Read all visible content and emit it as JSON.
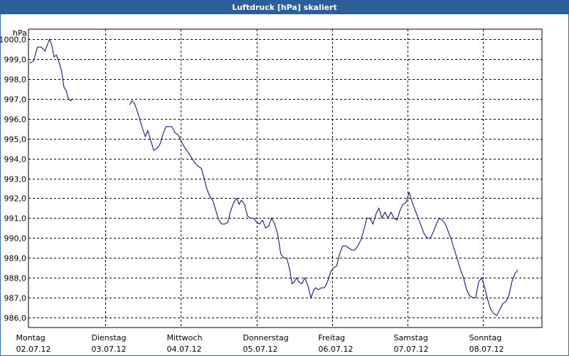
{
  "window": {
    "title": "Luftdruck [hPa] skaliert"
  },
  "chart_data": {
    "type": "line",
    "title": "Luftdruck [hPa] skaliert",
    "ylabel": "hPa",
    "xlabel": "",
    "ylim": [
      985.5,
      1000.5
    ],
    "yticks": [
      "986,0",
      "987,0",
      "988,0",
      "989,0",
      "990,0",
      "991,0",
      "992,0",
      "993,0",
      "994,0",
      "995,0",
      "996,0",
      "997,0",
      "998,0",
      "999,0",
      "1000,0"
    ],
    "ytick_values": [
      986,
      987,
      988,
      989,
      990,
      991,
      992,
      993,
      994,
      995,
      996,
      997,
      998,
      999,
      1000
    ],
    "xlim": [
      0,
      6.75
    ],
    "xticks": [
      {
        "day": "Montag",
        "date": "02.07.12",
        "x": 0
      },
      {
        "day": "Dienstag",
        "date": "03.07.12",
        "x": 1
      },
      {
        "day": "Mittwoch",
        "date": "04.07.12",
        "x": 2
      },
      {
        "day": "Donnerstag",
        "date": "05.07.12",
        "x": 3
      },
      {
        "day": "Freitag",
        "date": "06.07.12",
        "x": 4
      },
      {
        "day": "Samstag",
        "date": "07.07.12",
        "x": 5
      },
      {
        "day": "Sonntag",
        "date": "08.07.12",
        "x": 6
      }
    ],
    "grid": true,
    "colors": {
      "series": "#00008b",
      "grid": "#000000",
      "title_bg": "#2a5f97"
    },
    "series": [
      {
        "segments": [
          [
            [
              0.0,
              998.8
            ],
            [
              0.05,
              998.9
            ],
            [
              0.1,
              999.6
            ],
            [
              0.15,
              999.6
            ],
            [
              0.2,
              999.4
            ],
            [
              0.26,
              1000.0
            ],
            [
              0.29,
              999.7
            ],
            [
              0.32,
              999.1
            ],
            [
              0.35,
              999.2
            ],
            [
              0.38,
              998.9
            ],
            [
              0.42,
              998.4
            ],
            [
              0.45,
              997.6
            ],
            [
              0.48,
              997.4
            ],
            [
              0.51,
              997.0
            ],
            [
              0.54,
              996.9
            ],
            [
              0.57,
              997.0
            ]
          ],
          [
            [
              1.32,
              996.7
            ],
            [
              1.35,
              996.9
            ],
            [
              1.38,
              996.8
            ],
            [
              1.42,
              996.4
            ],
            [
              1.46,
              995.9
            ],
            [
              1.5,
              995.4
            ],
            [
              1.53,
              995.1
            ],
            [
              1.56,
              995.4
            ],
            [
              1.6,
              994.9
            ],
            [
              1.64,
              994.4
            ],
            [
              1.68,
              994.5
            ],
            [
              1.72,
              994.7
            ],
            [
              1.76,
              995.2
            ],
            [
              1.8,
              995.6
            ],
            [
              1.84,
              995.6
            ],
            [
              1.88,
              995.6
            ],
            [
              1.92,
              995.3
            ],
            [
              1.96,
              995.2
            ],
            [
              2.0,
              994.9
            ],
            [
              2.04,
              994.6
            ],
            [
              2.08,
              994.4
            ],
            [
              2.13,
              994.1
            ],
            [
              2.18,
              993.8
            ],
            [
              2.23,
              993.6
            ],
            [
              2.27,
              993.5
            ],
            [
              2.3,
              993.1
            ],
            [
              2.34,
              992.5
            ],
            [
              2.38,
              992.1
            ],
            [
              2.42,
              991.9
            ],
            [
              2.46,
              991.4
            ],
            [
              2.5,
              990.9
            ],
            [
              2.54,
              990.7
            ],
            [
              2.58,
              990.7
            ],
            [
              2.62,
              990.8
            ],
            [
              2.66,
              991.4
            ],
            [
              2.7,
              991.8
            ],
            [
              2.74,
              992.0
            ],
            [
              2.77,
              991.7
            ],
            [
              2.8,
              991.9
            ],
            [
              2.84,
              991.7
            ],
            [
              2.88,
              991.1
            ],
            [
              2.92,
              991.0
            ],
            [
              2.96,
              991.0
            ],
            [
              3.0,
              990.8
            ],
            [
              3.04,
              990.7
            ],
            [
              3.08,
              990.9
            ],
            [
              3.12,
              990.5
            ],
            [
              3.16,
              990.6
            ],
            [
              3.2,
              991.0
            ],
            [
              3.24,
              990.7
            ],
            [
              3.28,
              990.2
            ],
            [
              3.32,
              989.2
            ],
            [
              3.36,
              989.0
            ],
            [
              3.4,
              989.0
            ],
            [
              3.44,
              988.4
            ],
            [
              3.47,
              987.7
            ],
            [
              3.5,
              987.8
            ],
            [
              3.53,
              988.0
            ],
            [
              3.56,
              987.8
            ],
            [
              3.6,
              987.7
            ],
            [
              3.64,
              988.0
            ],
            [
              3.68,
              987.6
            ],
            [
              3.72,
              987.0
            ],
            [
              3.75,
              987.3
            ],
            [
              3.78,
              987.5
            ],
            [
              3.82,
              987.4
            ],
            [
              3.86,
              987.5
            ],
            [
              3.9,
              987.5
            ],
            [
              3.94,
              987.8
            ],
            [
              3.98,
              988.3
            ],
            [
              4.02,
              988.5
            ],
            [
              4.06,
              988.6
            ],
            [
              4.1,
              989.2
            ],
            [
              4.14,
              989.6
            ],
            [
              4.18,
              989.6
            ],
            [
              4.22,
              989.5
            ],
            [
              4.26,
              989.4
            ],
            [
              4.3,
              989.4
            ],
            [
              4.34,
              989.6
            ],
            [
              4.38,
              989.9
            ],
            [
              4.42,
              990.4
            ],
            [
              4.46,
              991.0
            ],
            [
              4.5,
              991.0
            ],
            [
              4.54,
              990.7
            ],
            [
              4.58,
              991.2
            ],
            [
              4.62,
              991.5
            ],
            [
              4.66,
              991.0
            ],
            [
              4.7,
              991.3
            ],
            [
              4.74,
              991.0
            ],
            [
              4.78,
              991.3
            ],
            [
              4.82,
              991.0
            ],
            [
              4.86,
              990.9
            ],
            [
              4.9,
              991.4
            ],
            [
              4.94,
              991.7
            ],
            [
              4.98,
              991.8
            ],
            [
              5.02,
              992.3
            ],
            [
              5.06,
              991.8
            ],
            [
              5.1,
              991.4
            ],
            [
              5.14,
              991.0
            ],
            [
              5.18,
              990.6
            ],
            [
              5.22,
              990.2
            ],
            [
              5.26,
              990.0
            ],
            [
              5.3,
              990.0
            ],
            [
              5.34,
              990.3
            ],
            [
              5.38,
              990.7
            ],
            [
              5.42,
              991.0
            ],
            [
              5.46,
              990.9
            ],
            [
              5.5,
              990.7
            ],
            [
              5.54,
              990.3
            ],
            [
              5.58,
              989.9
            ],
            [
              5.62,
              989.4
            ],
            [
              5.66,
              988.9
            ],
            [
              5.7,
              988.4
            ],
            [
              5.74,
              988.0
            ],
            [
              5.78,
              987.4
            ],
            [
              5.82,
              987.1
            ],
            [
              5.86,
              987.0
            ],
            [
              5.9,
              987.0
            ],
            [
              5.94,
              987.8
            ],
            [
              5.98,
              988.0
            ],
            [
              6.02,
              987.5
            ],
            [
              6.06,
              986.9
            ],
            [
              6.1,
              986.4
            ],
            [
              6.14,
              986.2
            ],
            [
              6.18,
              986.1
            ],
            [
              6.22,
              986.4
            ],
            [
              6.26,
              986.7
            ],
            [
              6.3,
              986.8
            ],
            [
              6.34,
              987.1
            ],
            [
              6.38,
              987.8
            ],
            [
              6.42,
              988.2
            ],
            [
              6.46,
              988.4
            ]
          ]
        ]
      }
    ]
  }
}
